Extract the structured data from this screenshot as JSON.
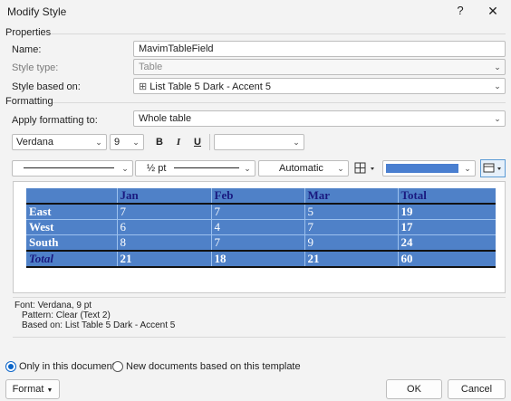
{
  "window": {
    "title": "Modify Style",
    "help": "?",
    "close": "✕"
  },
  "properties": {
    "section": "Properties",
    "name_label": "Name:",
    "name_value": "MavimTableField",
    "style_type_label": "Style type:",
    "style_type_value": "Table",
    "based_on_label": "Style based on:",
    "based_on_icon": "⊞",
    "based_on_value": "List Table 5 Dark - Accent 5"
  },
  "formatting": {
    "section": "Formatting",
    "apply_label": "Apply formatting to:",
    "apply_value": "Whole table",
    "font": "Verdana",
    "size": "9",
    "bold": "B",
    "italic": "I",
    "underline": "U",
    "color_value": "",
    "line_weight": "½ pt",
    "border_color": "Automatic",
    "shading_color": "#4a7fd0"
  },
  "preview": {
    "header": [
      "",
      "Jan",
      "Feb",
      "Mar",
      "Total"
    ],
    "rows": [
      [
        "East",
        "7",
        "7",
        "5",
        "19"
      ],
      [
        "West",
        "6",
        "4",
        "7",
        "17"
      ],
      [
        "South",
        "8",
        "7",
        "9",
        "24"
      ]
    ],
    "total": [
      "Total",
      "21",
      "18",
      "21",
      "60"
    ]
  },
  "description": {
    "line1": "Font: Verdana, 9 pt",
    "line2": "Pattern: Clear (Text 2)",
    "line3": "Based on: List Table 5 Dark - Accent 5"
  },
  "options": {
    "only_this_doc": "Only in this document",
    "new_docs": "New documents based on this template"
  },
  "buttons": {
    "format": "Format",
    "ok": "OK",
    "cancel": "Cancel"
  }
}
